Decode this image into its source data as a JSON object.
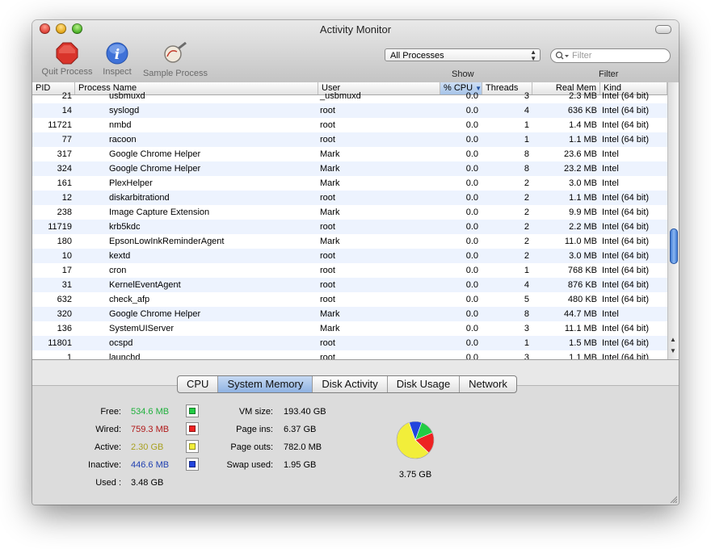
{
  "window": {
    "title": "Activity Monitor"
  },
  "toolbar": {
    "quit_label": "Quit Process",
    "inspect_label": "Inspect",
    "sample_label": "Sample Process"
  },
  "show": {
    "label": "Show",
    "selected": "All Processes"
  },
  "filter": {
    "label": "Filter",
    "placeholder": "Filter",
    "value": ""
  },
  "table": {
    "columns": {
      "pid": "PID",
      "name": "Process Name",
      "user": "User",
      "cpu": "% CPU",
      "threads": "Threads",
      "mem": "Real Mem",
      "kind": "Kind"
    },
    "sorted_column": "cpu",
    "rows": [
      {
        "pid": "21",
        "name": "usbmuxd",
        "user": "_usbmuxd",
        "cpu": "0.0",
        "threads": "3",
        "mem": "2.3 MB",
        "kind": "Intel (64 bit)"
      },
      {
        "pid": "14",
        "name": "syslogd",
        "user": "root",
        "cpu": "0.0",
        "threads": "4",
        "mem": "636 KB",
        "kind": "Intel (64 bit)"
      },
      {
        "pid": "11721",
        "name": "nmbd",
        "user": "root",
        "cpu": "0.0",
        "threads": "1",
        "mem": "1.4 MB",
        "kind": "Intel (64 bit)"
      },
      {
        "pid": "77",
        "name": "racoon",
        "user": "root",
        "cpu": "0.0",
        "threads": "1",
        "mem": "1.1 MB",
        "kind": "Intel (64 bit)"
      },
      {
        "pid": "317",
        "name": "Google Chrome Helper",
        "user": "Mark",
        "cpu": "0.0",
        "threads": "8",
        "mem": "23.6 MB",
        "kind": "Intel"
      },
      {
        "pid": "324",
        "name": "Google Chrome Helper",
        "user": "Mark",
        "cpu": "0.0",
        "threads": "8",
        "mem": "23.2 MB",
        "kind": "Intel"
      },
      {
        "pid": "161",
        "name": "PlexHelper",
        "user": "Mark",
        "cpu": "0.0",
        "threads": "2",
        "mem": "3.0 MB",
        "kind": "Intel"
      },
      {
        "pid": "12",
        "name": "diskarbitrationd",
        "user": "root",
        "cpu": "0.0",
        "threads": "2",
        "mem": "1.1 MB",
        "kind": "Intel (64 bit)"
      },
      {
        "pid": "238",
        "name": "Image Capture Extension",
        "user": "Mark",
        "cpu": "0.0",
        "threads": "2",
        "mem": "9.9 MB",
        "kind": "Intel (64 bit)"
      },
      {
        "pid": "11719",
        "name": "krb5kdc",
        "user": "root",
        "cpu": "0.0",
        "threads": "2",
        "mem": "2.2 MB",
        "kind": "Intel (64 bit)"
      },
      {
        "pid": "180",
        "name": "EpsonLowInkReminderAgent",
        "user": "Mark",
        "cpu": "0.0",
        "threads": "2",
        "mem": "11.0 MB",
        "kind": "Intel (64 bit)"
      },
      {
        "pid": "10",
        "name": "kextd",
        "user": "root",
        "cpu": "0.0",
        "threads": "2",
        "mem": "3.0 MB",
        "kind": "Intel (64 bit)"
      },
      {
        "pid": "17",
        "name": "cron",
        "user": "root",
        "cpu": "0.0",
        "threads": "1",
        "mem": "768 KB",
        "kind": "Intel (64 bit)"
      },
      {
        "pid": "31",
        "name": "KernelEventAgent",
        "user": "root",
        "cpu": "0.0",
        "threads": "4",
        "mem": "876 KB",
        "kind": "Intel (64 bit)"
      },
      {
        "pid": "632",
        "name": "check_afp",
        "user": "root",
        "cpu": "0.0",
        "threads": "5",
        "mem": "480 KB",
        "kind": "Intel (64 bit)"
      },
      {
        "pid": "320",
        "name": "Google Chrome Helper",
        "user": "Mark",
        "cpu": "0.0",
        "threads": "8",
        "mem": "44.7 MB",
        "kind": "Intel"
      },
      {
        "pid": "136",
        "name": "SystemUIServer",
        "user": "Mark",
        "cpu": "0.0",
        "threads": "3",
        "mem": "11.1 MB",
        "kind": "Intel (64 bit)"
      },
      {
        "pid": "11801",
        "name": "ocspd",
        "user": "root",
        "cpu": "0.0",
        "threads": "1",
        "mem": "1.5 MB",
        "kind": "Intel (64 bit)"
      },
      {
        "pid": "1",
        "name": "launchd",
        "user": "root",
        "cpu": "0.0",
        "threads": "3",
        "mem": "1.1 MB",
        "kind": "Intel (64 bit)"
      }
    ]
  },
  "tabs": [
    "CPU",
    "System Memory",
    "Disk Activity",
    "Disk Usage",
    "Network"
  ],
  "active_tab": "System Memory",
  "memory": {
    "free": {
      "label": "Free:",
      "value": "534.6 MB",
      "color": "#1fb03c",
      "swatch": "#22cc44"
    },
    "wired": {
      "label": "Wired:",
      "value": "759.3 MB",
      "color": "#b01818",
      "swatch": "#ee2222"
    },
    "active": {
      "label": "Active:",
      "value": "2.30 GB",
      "color": "#a8a020",
      "swatch": "#f2ee3a"
    },
    "inactive": {
      "label": "Inactive:",
      "value": "446.6 MB",
      "color": "#1f3fb0",
      "swatch": "#2244dd"
    },
    "used": {
      "label": "Used :",
      "value": "3.48 GB"
    }
  },
  "vm": {
    "vm_size": {
      "label": "VM size:",
      "value": "193.40 GB"
    },
    "page_ins": {
      "label": "Page ins:",
      "value": "6.37 GB"
    },
    "page_outs": {
      "label": "Page outs:",
      "value": "782.0 MB"
    },
    "swap_used": {
      "label": "Swap used:",
      "value": "1.95 GB"
    }
  },
  "pie": {
    "total": "3.75 GB",
    "slices_gb": [
      {
        "name": "free",
        "value": 0.522,
        "color": "#22cc44"
      },
      {
        "name": "wired",
        "value": 0.741,
        "color": "#ee2222"
      },
      {
        "name": "active",
        "value": 2.3,
        "color": "#f2ee3a"
      },
      {
        "name": "inactive",
        "value": 0.436,
        "color": "#2244dd"
      }
    ]
  },
  "icons": {
    "quit": "stop-sign-icon",
    "inspect": "info-icon",
    "sample": "magnifier-sample-icon",
    "search": "search-icon"
  }
}
